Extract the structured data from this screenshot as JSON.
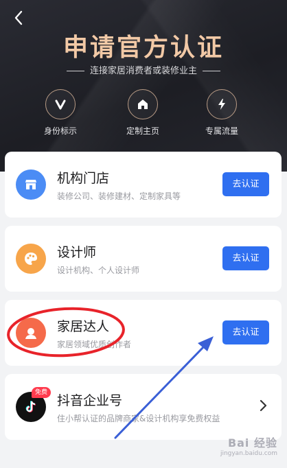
{
  "header": {
    "back_icon": "chevron-left-icon",
    "title": "申请官方认证",
    "subtitle": "连接家居消费者或装修业主"
  },
  "perks": [
    {
      "label": "身份标示",
      "icon": "v-badge-icon"
    },
    {
      "label": "定制主页",
      "icon": "home-icon"
    },
    {
      "label": "专属流量",
      "icon": "lightning-icon"
    }
  ],
  "cards": [
    {
      "title": "机构门店",
      "desc": "装修公司、装修建材、定制家具等",
      "button": "去认证",
      "icon": "store-icon",
      "color": "#4b8cf5"
    },
    {
      "title": "设计师",
      "desc": "设计机构、个人设计师",
      "button": "去认证",
      "icon": "palette-icon",
      "color": "#f7a54a"
    },
    {
      "title": "家居达人",
      "desc": "家居领域优质创作者",
      "button": "去认证",
      "icon": "user-icon",
      "color": "#f56a4a"
    },
    {
      "title": "抖音企业号",
      "desc": "住小帮认证的品牌商家&设计机构享免费权益",
      "icon": "tiktok-icon",
      "badge": "免费",
      "color": "#111111"
    }
  ],
  "watermark": {
    "line1": "Bai 经验",
    "line2": "jingyan.baidu.com"
  }
}
